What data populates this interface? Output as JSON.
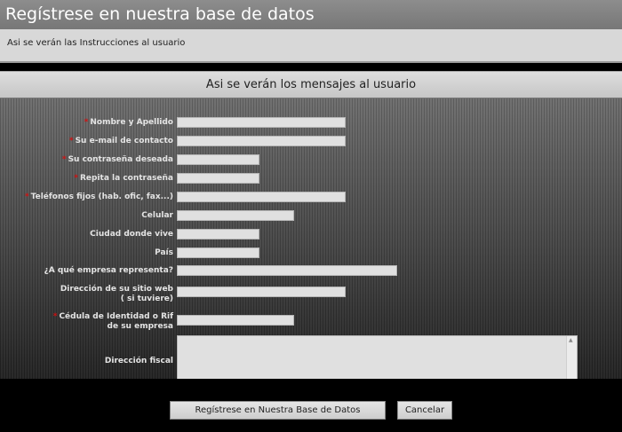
{
  "header": {
    "title": "Regístrese en nuestra base de datos"
  },
  "instructions": {
    "text": "Asi se verán las Instrucciones al usuario"
  },
  "messages": {
    "text": "Asi se verán los mensajes al usuario"
  },
  "form": {
    "fields": [
      {
        "label": "Nombre y Apellido",
        "required": true,
        "value": ""
      },
      {
        "label": "Su e-mail de contacto",
        "required": true,
        "value": ""
      },
      {
        "label": "Su contraseña deseada",
        "required": true,
        "value": ""
      },
      {
        "label": "Repita la contraseña",
        "required": true,
        "value": ""
      },
      {
        "label": "Teléfonos fijos (hab. ofic, fax...)",
        "required": true,
        "value": ""
      },
      {
        "label": "Celular",
        "required": false,
        "value": ""
      },
      {
        "label": "Ciudad donde vive",
        "required": false,
        "value": ""
      },
      {
        "label": "País",
        "required": false,
        "value": ""
      },
      {
        "label": "¿A qué empresa representa?",
        "required": false,
        "value": ""
      },
      {
        "label": "Dirección de su sitio web ( si tuviere)",
        "required": false,
        "value": ""
      },
      {
        "label": "Cédula de Identidad o Rif de su empresa",
        "required": true,
        "value": ""
      },
      {
        "label": "Dirección fiscal",
        "required": false,
        "value": ""
      }
    ],
    "required_marker": "*"
  },
  "buttons": {
    "submit_label": "Regístrese en Nuestra Base de Datos",
    "cancel_label": "Cancelar"
  },
  "colors": {
    "required": "#d01010",
    "header_bg": "#808080"
  }
}
